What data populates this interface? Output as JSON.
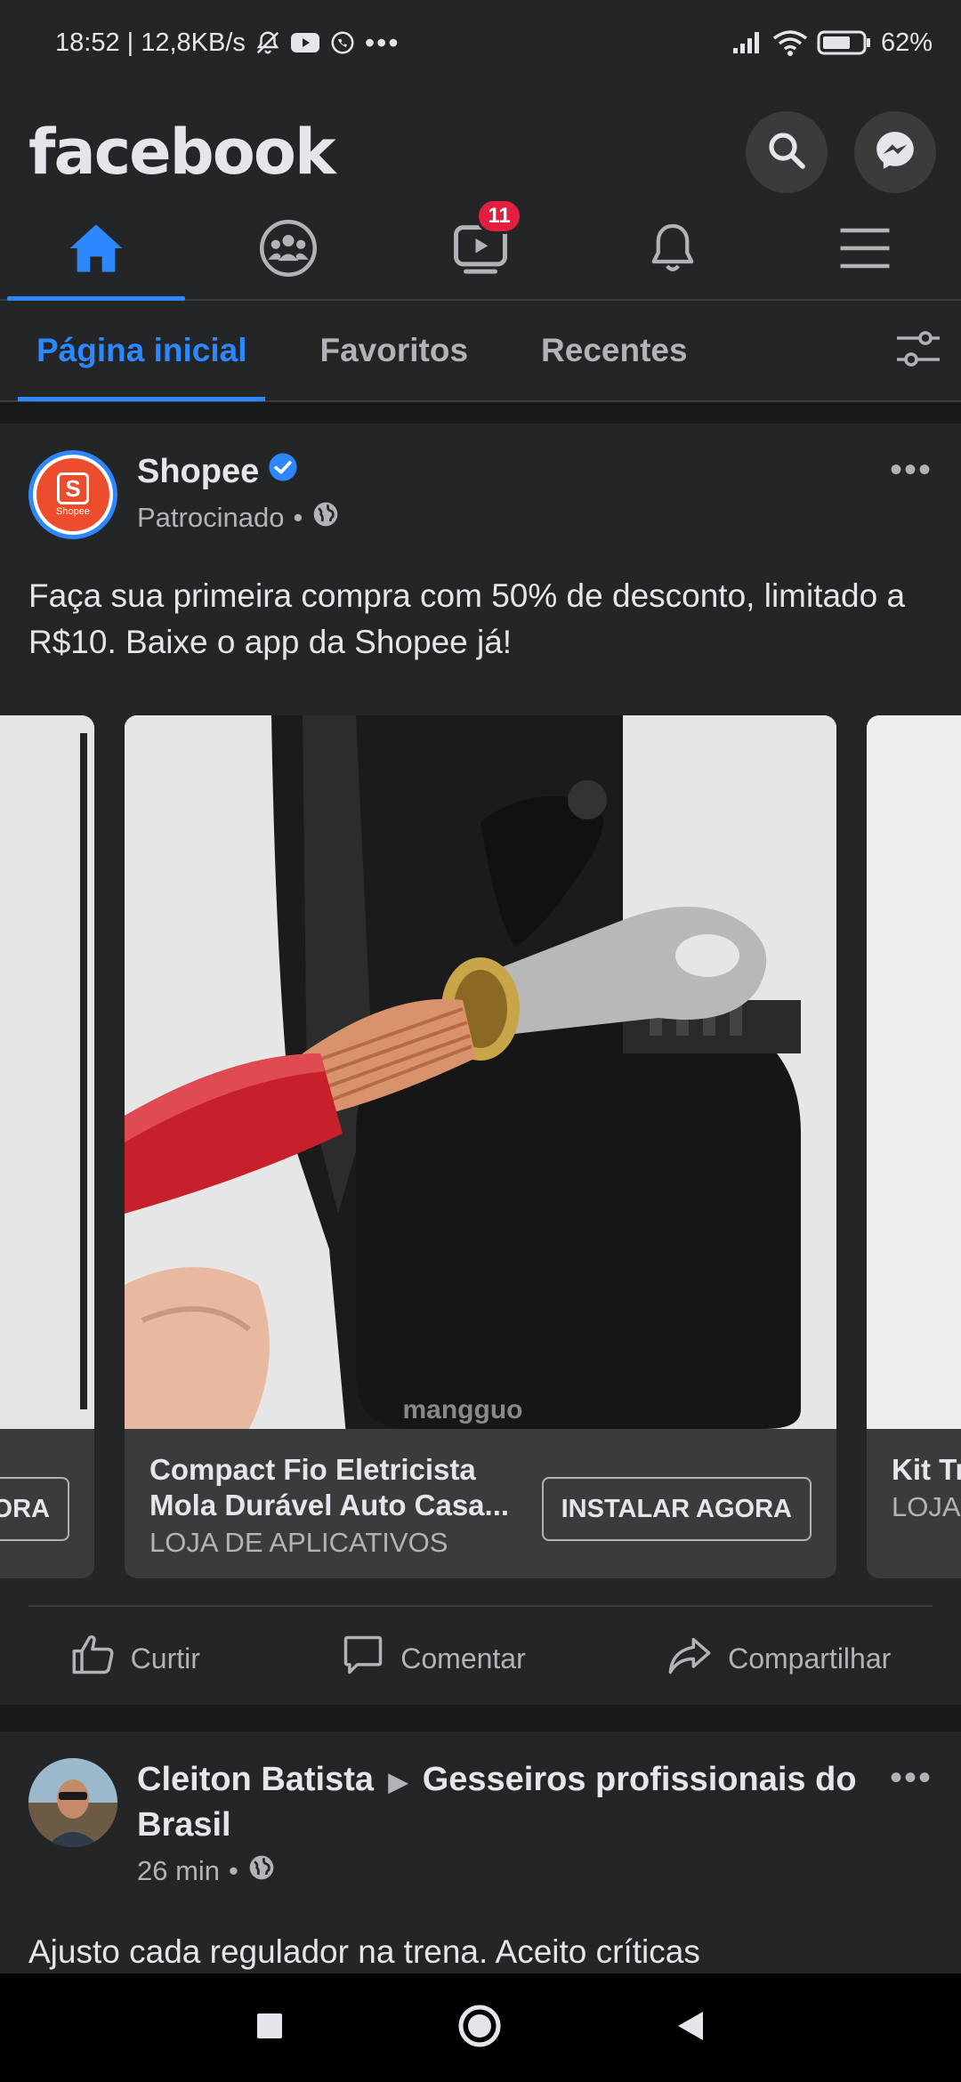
{
  "status_bar": {
    "time_speed": "18:52 | 12,8KB/s",
    "battery": "62%"
  },
  "header": {
    "logo": "facebook",
    "icons": [
      "search-icon",
      "messenger-icon"
    ]
  },
  "nav_tabs": [
    {
      "icon": "home-icon",
      "active": true
    },
    {
      "icon": "groups-icon",
      "active": false
    },
    {
      "icon": "watch-icon",
      "active": false,
      "badge": "11"
    },
    {
      "icon": "bell-icon",
      "active": false
    },
    {
      "icon": "menu-icon",
      "active": false
    }
  ],
  "feed_filter": {
    "items": [
      "Página inicial",
      "Favoritos",
      "Recentes"
    ],
    "active": "Página inicial"
  },
  "post1": {
    "author": "Shopee",
    "verified": true,
    "meta": "Patrocinado",
    "text": "Faça sua primeira compra com 50% de desconto, limitado a R$10. Baixe o app da Shopee já!",
    "avatar_label": "Shopee",
    "avatar_letter": "S",
    "watermark": "mangguo",
    "cards": {
      "left": {
        "cta": "ORA"
      },
      "center": {
        "title": "Compact Fio Eletricista Mola Durável Auto Casa...",
        "source": "LOJA DE APLICATIVOS",
        "cta": "INSTALAR AGORA"
      },
      "right": {
        "title": "Kit Tr +bon",
        "source": "LOJA"
      }
    },
    "actions": {
      "like": "Curtir",
      "comment": "Comentar",
      "share": "Compartilhar"
    }
  },
  "post2": {
    "author": "Cleiton Batista",
    "group": "Gesseiros profissionais do Brasil",
    "meta": "26 min",
    "text": "Ajusto cada regulador na trena. Aceito críticas"
  },
  "colors": {
    "accent": "#2d88ff",
    "background": "#18191a",
    "surface": "#242526",
    "badge": "#e41e3f",
    "shopee": "#ee4d2d"
  }
}
